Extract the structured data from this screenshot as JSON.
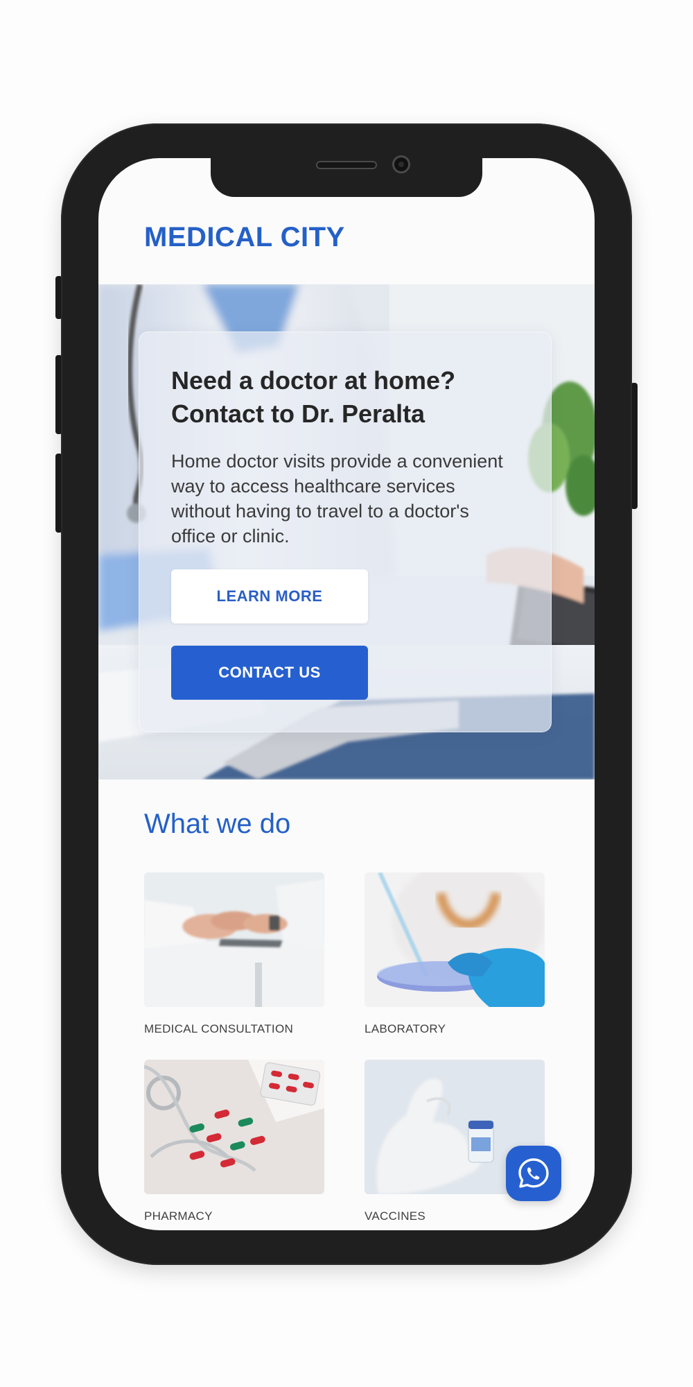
{
  "header": {
    "brand": "MEDICAL CITY"
  },
  "hero": {
    "title_line1": "Need a doctor at home?",
    "title_line2": "Contact to Dr. Peralta",
    "description": "Home doctor visits provide a convenient way to access healthcare services without having to travel to a doctor's office or clinic.",
    "learn_more_label": "LEARN MORE",
    "contact_label": "CONTACT US"
  },
  "services": {
    "title": "What we do",
    "items": [
      {
        "label": "MEDICAL CONSULTATION",
        "icon": "consultation-photo"
      },
      {
        "label": "LABORATORY",
        "icon": "laboratory-photo"
      },
      {
        "label": "PHARMACY",
        "icon": "pharmacy-photo"
      },
      {
        "label": "VACCINES",
        "icon": "vaccines-photo"
      }
    ]
  },
  "fab": {
    "icon": "whatsapp-icon"
  },
  "colors": {
    "brand": "#2460c8",
    "primary_button": "#2660d0",
    "phone_frame": "#1f1f1f"
  }
}
